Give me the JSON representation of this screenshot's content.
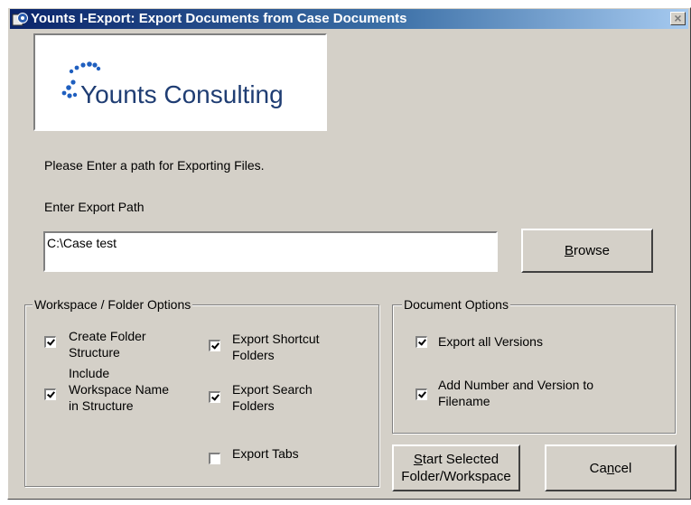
{
  "window": {
    "title": "Younts I-Export: Export Documents from Case Documents",
    "close_label": "×"
  },
  "logo": {
    "text": "Younts Consulting"
  },
  "instructions": "Please Enter a path for Exporting Files.",
  "export_path": {
    "label": "Enter Export Path",
    "value": "C:\\Case test"
  },
  "buttons": {
    "browse_prefix": "",
    "browse_underline": "B",
    "browse_rest": "rowse",
    "start_underline": "S",
    "start_line1": "tart Selected",
    "start_line2": "Folder/Workspace",
    "cancel_prefix": "Ca",
    "cancel_underline": "n",
    "cancel_rest": "cel"
  },
  "workspace_group": {
    "title": "Workspace / Folder Options",
    "options": [
      {
        "lines": [
          "Create Folder",
          "Structure"
        ],
        "checked": true
      },
      {
        "lines": [
          "Include",
          "Workspace Name",
          "in Structure"
        ],
        "checked": true
      },
      {
        "lines": [
          "Export Shortcut",
          "Folders"
        ],
        "checked": true
      },
      {
        "lines": [
          "Export Search",
          "Folders"
        ],
        "checked": true
      },
      {
        "lines": [
          "Export Tabs"
        ],
        "checked": false
      }
    ]
  },
  "document_group": {
    "title": "Document Options",
    "options": [
      {
        "lines": [
          "Export all Versions"
        ],
        "checked": true
      },
      {
        "lines": [
          "Add Number and Version to",
          "Filename"
        ],
        "checked": true
      }
    ]
  }
}
